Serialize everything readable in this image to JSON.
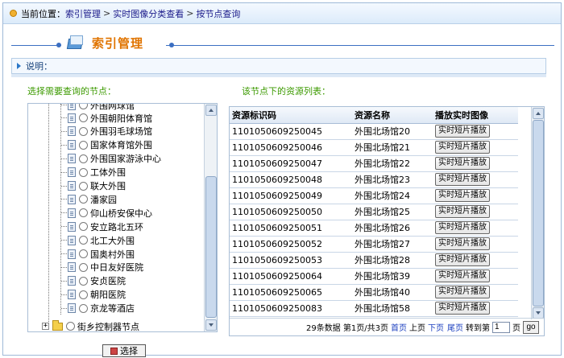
{
  "breadcrumb": {
    "prefix": "当前位置：",
    "items": [
      "索引管理",
      "实时图像分类查看",
      "按节点查询"
    ],
    "separator": ">"
  },
  "page_title": "索引管理",
  "note_label": "说明：",
  "left_label": "选择需要查询的节点：",
  "right_label": "该节点下的资源列表：",
  "tree": {
    "partial_top": "外围网球馆",
    "nodes": [
      "外围朝阳体育馆",
      "外围羽毛球场馆",
      "国家体育馆外围",
      "外围国家游泳中心",
      "工体外围",
      "联大外围",
      "潘家园",
      "仰山桥安保中心",
      "安立路北五环",
      "北工大外围",
      "国奥村外围",
      "中日友好医院",
      "安贞医院",
      "朝阳医院",
      "京龙等酒店"
    ],
    "root_node": "街乡控制器节点"
  },
  "select_button": "选择",
  "table": {
    "headers": [
      "资源标识码",
      "资源名称",
      "播放实时图像"
    ],
    "play_label": "实时短片播放",
    "rows": [
      {
        "id": "110105060925004​5",
        "name": "外围北场馆20"
      },
      {
        "id": "1101050609250046",
        "name": "外围北场馆21"
      },
      {
        "id": "1101050609250047",
        "name": "外围北场馆22"
      },
      {
        "id": "1101050609250048",
        "name": "外围北场馆23"
      },
      {
        "id": "1101050609250049",
        "name": "外围北场馆24"
      },
      {
        "id": "1101050609250050",
        "name": "外围北场馆25"
      },
      {
        "id": "1101050609250051",
        "name": "外围北场馆26"
      },
      {
        "id": "1101050609250052",
        "name": "外围北场馆27"
      },
      {
        "id": "1101050609250053",
        "name": "外围北场馆28"
      },
      {
        "id": "1101050609250064",
        "name": "外围北场馆39"
      },
      {
        "id": "1101050609250065",
        "name": "外围北场馆40"
      },
      {
        "id": "1101050609250083",
        "name": "外围北场馆58"
      }
    ]
  },
  "pager": {
    "summary": "29条数据 第1页/共3页",
    "first": "首页",
    "prev": "上页",
    "next": "下页",
    "last": "尾页",
    "goto_label": "转到第",
    "page_value": "1",
    "page_unit": "页",
    "go": "go"
  }
}
